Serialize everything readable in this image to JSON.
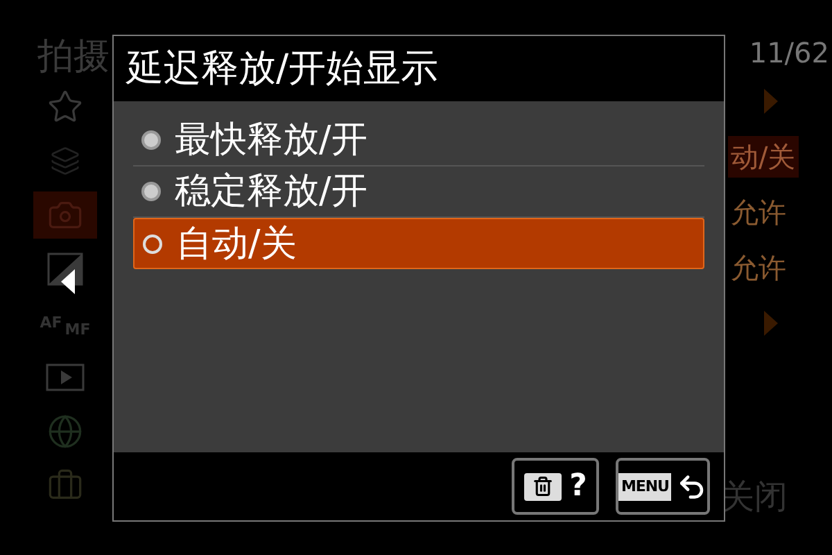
{
  "background": {
    "breadcrumb": "拍摄",
    "page": "11/62",
    "sidebar": [
      {
        "kind": "star",
        "selected": false
      },
      {
        "kind": "custom",
        "selected": false
      },
      {
        "kind": "camera",
        "selected": true
      },
      {
        "kind": "exposure",
        "selected": false
      },
      {
        "kind": "afmf",
        "selected": false,
        "labels": [
          "AF",
          "MF"
        ]
      },
      {
        "kind": "play",
        "selected": false
      },
      {
        "kind": "globe",
        "selected": false
      },
      {
        "kind": "toolbox",
        "selected": false
      }
    ],
    "values": [
      {
        "kind": "arrow"
      },
      {
        "kind": "text",
        "text": "动/关",
        "selected": true
      },
      {
        "kind": "text",
        "text": "允许",
        "selected": false
      },
      {
        "kind": "text",
        "text": "允许",
        "selected": false
      },
      {
        "kind": "arrow"
      }
    ],
    "close": "关闭"
  },
  "dialog": {
    "title": "延迟释放/开始显示",
    "options": [
      {
        "label": "最快释放/开",
        "selected": false
      },
      {
        "label": "稳定释放/开",
        "selected": false
      },
      {
        "label": "自动/关",
        "selected": true
      }
    ],
    "buttons": [
      {
        "kind": "delete_help",
        "label": "?"
      },
      {
        "kind": "menu_back",
        "label": "MENU"
      }
    ]
  }
}
